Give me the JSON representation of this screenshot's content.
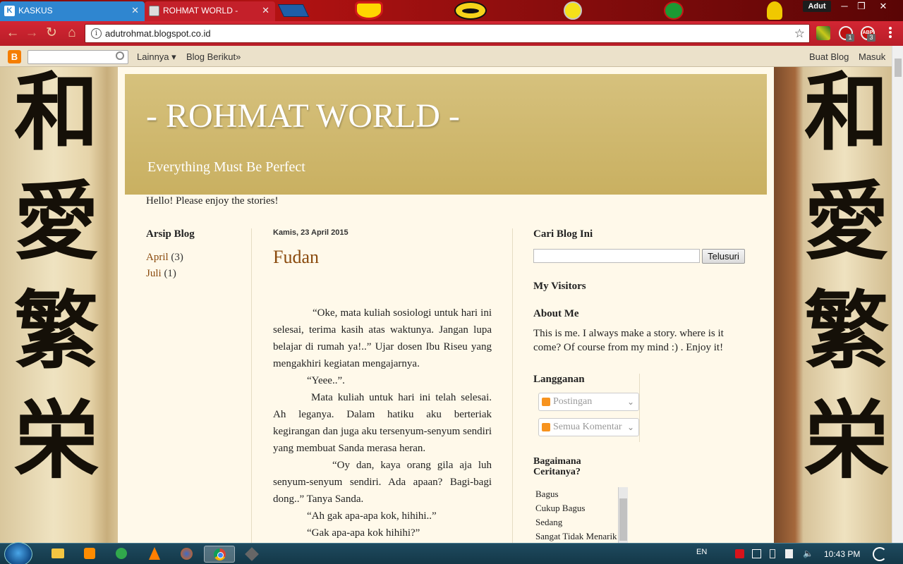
{
  "browser": {
    "tabs": [
      {
        "title": "KASKUS"
      },
      {
        "title": "ROHMAT WORLD -"
      }
    ],
    "profile": "Adut",
    "url": "adutrohmat.blogspot.co.id",
    "extension_badges": {
      "ublock": "1",
      "abp": "3",
      "abp_label": "ABP"
    },
    "accent_color": "#c4202a"
  },
  "blogger_navbar": {
    "more": "Lainnya ▾",
    "next_blog": "Blog Berikut»",
    "create_blog": "Buat Blog",
    "sign_in": "Masuk"
  },
  "blog": {
    "title": "- ROHMAT WORLD -",
    "description": "Everything Must Be Perfect",
    "tagline": "Hello! Please enjoy the stories!",
    "background_kanji": [
      "和",
      "愛",
      "繁",
      "栄"
    ]
  },
  "archive": {
    "heading": "Arsip Blog",
    "items": [
      {
        "label": "April",
        "count": "(3)"
      },
      {
        "label": "Juli",
        "count": "(1)"
      }
    ]
  },
  "post": {
    "date": "Kamis, 23 April 2015",
    "title": "Fudan",
    "paragraphs": [
      "            “Oke, mata kuliah sosiologi untuk hari ini selesai, terima kasih atas waktunya. Jangan lupa belajar di rumah ya!..” Ujar dosen Ibu Riseu yang mengakhiri kegiatan mengajarnya.",
      "            “Yeee..”.",
      "            Mata kuliah untuk hari ini telah selesai. Ah leganya. Dalam hatiku aku berteriak kegirangan dan juga aku tersenyum-senyum sendiri yang membuat Sanda merasa heran.",
      "                        “Oy dan, kaya orang gila aja luh senyum-senyum sendiri. Ada apaan? Bagi-bagi dong..” Tanya Sanda.",
      "            “Ah gak apa-apa kok, hihihi..”",
      "            “Gak apa-apa kok hihihi?”"
    ]
  },
  "sidebar": {
    "search_heading": "Cari Blog Ini",
    "search_button": "Telusuri",
    "visitors_heading": "My Visitors",
    "about_heading": "About Me",
    "about_text": "This is me. I always make a story. where is it come? Of course from my mind :) . Enjoy it!",
    "subscribe_heading": "Langganan",
    "feeds": [
      "Postingan",
      "Semua Komentar"
    ],
    "poll_heading": "Bagaimana Ceritanya?",
    "poll_options": [
      "Bagus",
      "Cukup Bagus",
      "Sedang",
      "Sangat Tidak Menarik"
    ]
  },
  "taskbar": {
    "language": "EN",
    "clock": "10:43 PM"
  }
}
